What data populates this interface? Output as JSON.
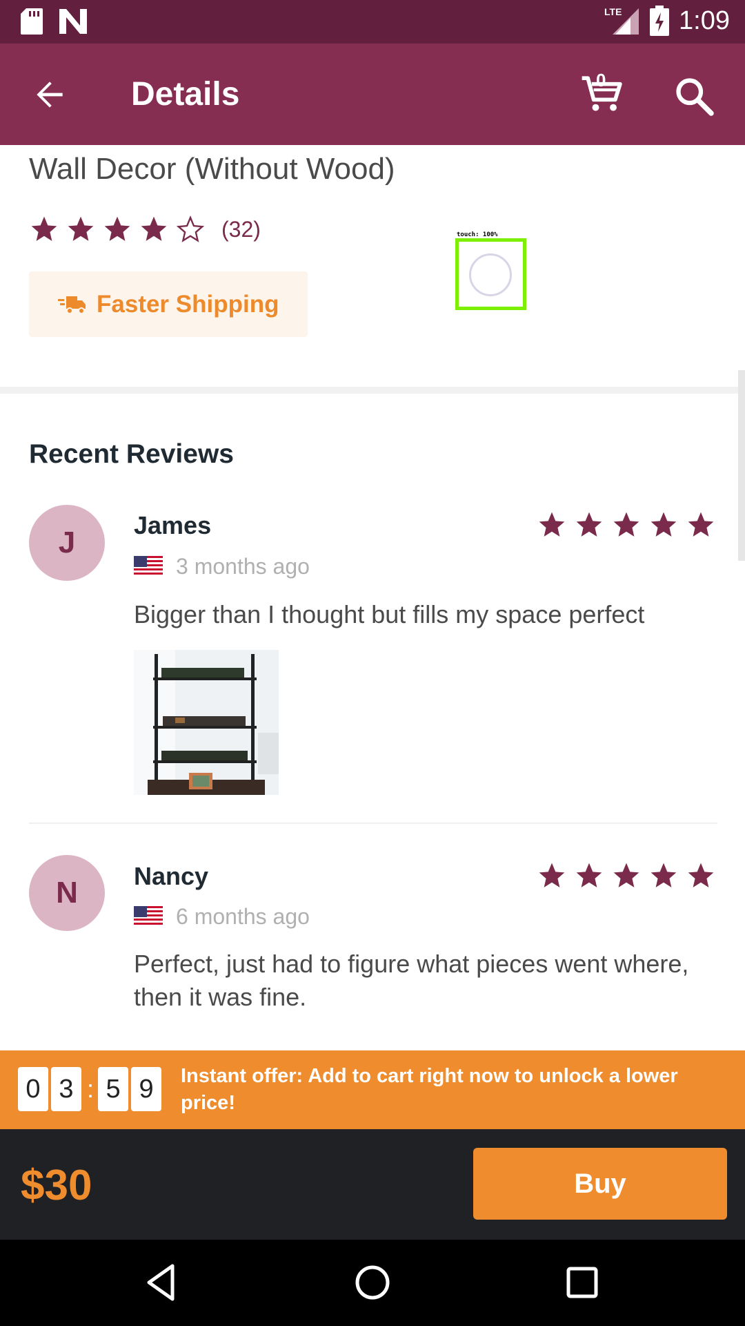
{
  "status_bar": {
    "network": "LTE",
    "time": "1:09"
  },
  "app_bar": {
    "title": "Details",
    "cart_count": "0"
  },
  "product": {
    "title_visible": "Wall Decor (Without Wood)",
    "rating": 4,
    "rating_count": "(32)",
    "shipping_badge": "Faster Shipping"
  },
  "touch_overlay": {
    "label": "touch: 100%"
  },
  "reviews_section": {
    "title": "Recent Reviews",
    "reviews": [
      {
        "initial": "J",
        "name": "James",
        "stars": 5,
        "when": "3 months ago",
        "text": "Bigger than I thought but fills my space perfect"
      },
      {
        "initial": "N",
        "name": "Nancy",
        "stars": 5,
        "when": "6 months ago",
        "text": "Perfect, just had to figure what pieces went where, then it was fine."
      }
    ]
  },
  "offer": {
    "digits": [
      "0",
      "3",
      "5",
      "9"
    ],
    "separator": ":",
    "text": "Instant offer: Add to cart right now to unlock a lower price!"
  },
  "buy_bar": {
    "price": "$30",
    "buy_label": "Buy"
  },
  "colors": {
    "brand": "#862d52",
    "status": "#62203e",
    "accent": "#ee8c2e",
    "star": "#7a2a4a"
  }
}
